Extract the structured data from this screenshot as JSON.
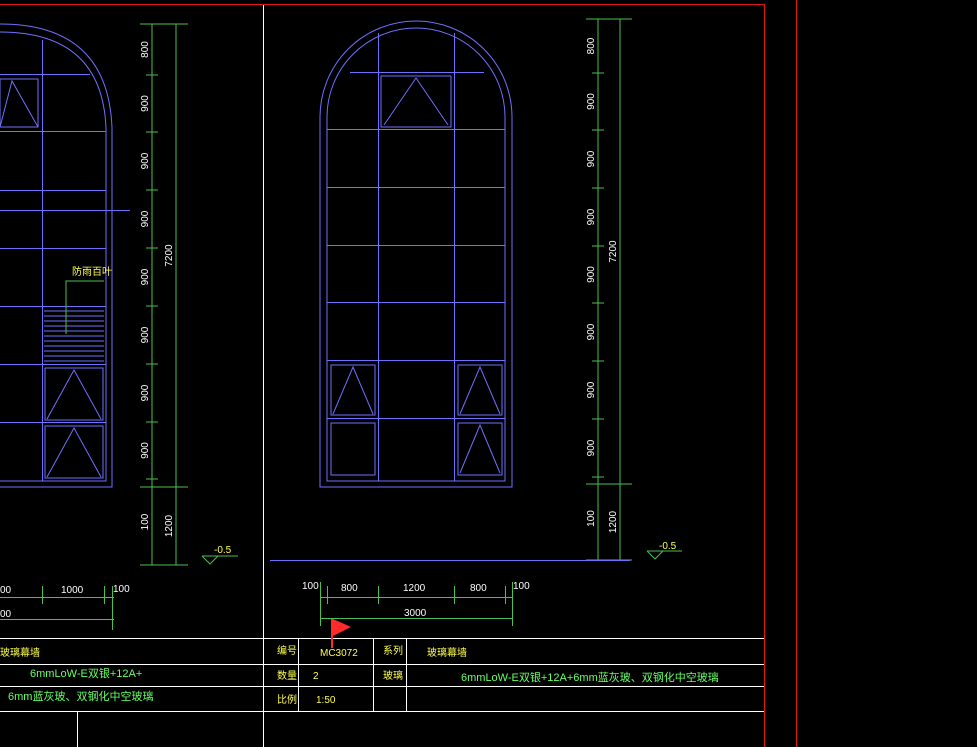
{
  "colors": {
    "background": "#000000",
    "border": "#e01818",
    "window_lines": "#6f6fff",
    "dimension_lines": "#4cbf4c",
    "label_text": "#ffff4d",
    "callout_text": "#66ff66",
    "dimension_text": "#ffffff",
    "marker_flag": "#ff2a2a"
  },
  "left_elevation": {
    "vertical_dims": [
      "800",
      "900",
      "900",
      "900",
      "900",
      "900",
      "900",
      "900",
      "100",
      "1200"
    ],
    "total_dims": [
      "7200",
      "1200"
    ],
    "callout": "防雨百叶",
    "level": "-0.5",
    "bottom_dims": [
      "00",
      "1000",
      "100"
    ],
    "bottom_total": "00"
  },
  "right_elevation": {
    "vertical_dims": [
      "800",
      "900",
      "900",
      "900",
      "900",
      "900",
      "900",
      "900",
      "100",
      "1200"
    ],
    "total_dims": [
      "7200",
      "1200"
    ],
    "level": "-0.5",
    "bottom_dims": [
      "100",
      "800",
      "1200",
      "800",
      "100"
    ],
    "bottom_total": "3000"
  },
  "title_block": {
    "left_series": "玻璃幕墙",
    "left_glass_line1": "6mmLoW-E双银+12A+",
    "left_glass_line2": "6mm蓝灰玻、双钢化中空玻璃",
    "label_code": "编号",
    "code_value": "MC3072",
    "label_quantity": "数量",
    "quantity_value": "2",
    "label_scale": "比例",
    "scale_value": "1:50",
    "label_series": "系列",
    "series_value": "玻璃幕墙",
    "label_glass": "玻璃",
    "glass_value": "6mmLoW-E双银+12A+6mm蓝灰玻、双钢化中空玻璃"
  }
}
